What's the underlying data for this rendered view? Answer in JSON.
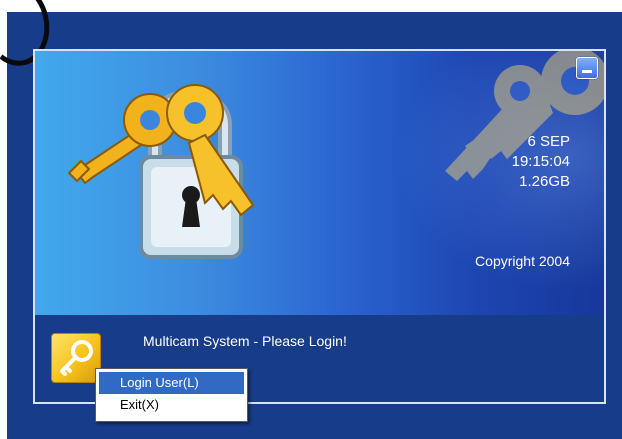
{
  "window": {
    "info": {
      "date": "6 SEP",
      "time": "19:15:04",
      "storage": "1.26GB"
    },
    "copyright": "Copyright 2004",
    "login_prompt": "Multicam System - Please Login!"
  },
  "context_menu": {
    "items": [
      {
        "label": "Login User(L)",
        "selected": true
      },
      {
        "label": "Exit(X)",
        "selected": false
      }
    ]
  },
  "colors": {
    "frame": "#163c8a",
    "menu_highlight": "#316ac5",
    "key_gold": "#f2b21c"
  },
  "icons": [
    "lock-keys-icon",
    "minimize-icon",
    "key-login-icon"
  ]
}
